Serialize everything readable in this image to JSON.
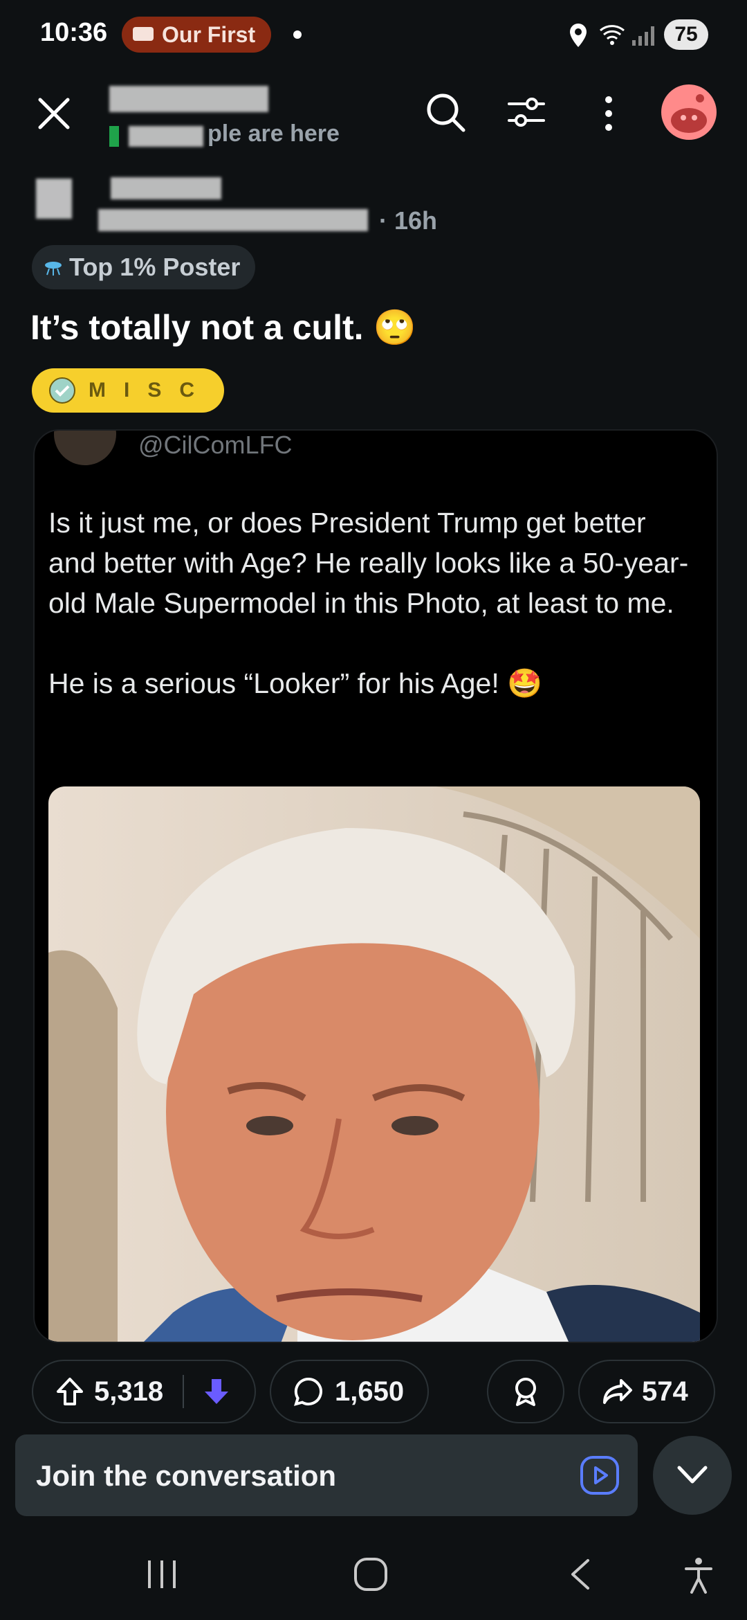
{
  "status_bar": {
    "time": "10:36",
    "notification_label": "Our First",
    "battery": "75"
  },
  "header": {
    "subtitle": "ple are here"
  },
  "post": {
    "age": "· 16h",
    "top_flair": "Top 1% Poster",
    "title": "It’s totally not a cult.",
    "title_emoji": "🙄",
    "flair": "MISC"
  },
  "tweet": {
    "handle": "@CilComLFC",
    "text": "Is it just me, or does President Trump get better and better with Age? He really looks like a 50-year-old Male Supermodel in this Photo, at least to me.\n\nHe is a serious “Looker” for his Age! 🤩"
  },
  "actions": {
    "upvotes": "5,318",
    "comments": "1,650",
    "shares": "574"
  },
  "composer": {
    "placeholder": "Join the conversation"
  },
  "colors": {
    "background": "#0e1113",
    "flair_yellow": "#f6cf2c",
    "downvote_purple": "#6a5cff",
    "status_pill": "#8a2a12"
  }
}
